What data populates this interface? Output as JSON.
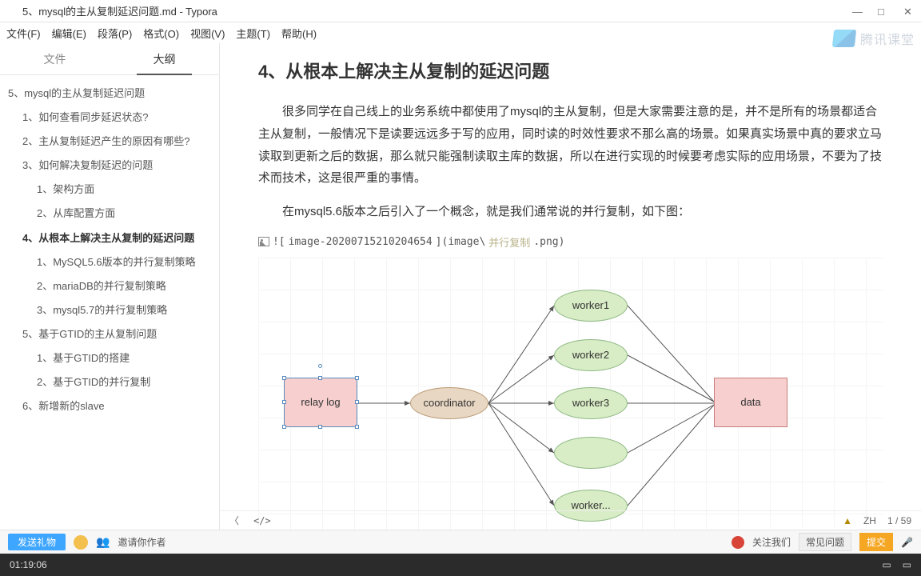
{
  "window": {
    "title": "5、mysql的主从复制延迟问题.md - Typora",
    "min": "—",
    "max": "□",
    "close": "✕"
  },
  "menu": {
    "file": "文件(F)",
    "edit": "编辑(E)",
    "paragraph": "段落(P)",
    "format": "格式(O)",
    "view": "视图(V)",
    "theme": "主题(T)",
    "help": "帮助(H)"
  },
  "sidebar": {
    "tab_file": "文件",
    "tab_outline": "大纲",
    "items": [
      {
        "text": "5、mysql的主从复制延迟问题",
        "level": "l1"
      },
      {
        "text": "1、如何查看同步延迟状态?",
        "level": "l2"
      },
      {
        "text": "2、主从复制延迟产生的原因有哪些?",
        "level": "l2"
      },
      {
        "text": "3、如何解决复制延迟的问题",
        "level": "l2"
      },
      {
        "text": "1、架构方面",
        "level": "l3"
      },
      {
        "text": "2、从库配置方面",
        "level": "l3"
      },
      {
        "text": "4、从根本上解决主从复制的延迟问题",
        "level": "l2",
        "bold": true
      },
      {
        "text": "1、MySQL5.6版本的并行复制策略",
        "level": "l3"
      },
      {
        "text": "2、mariaDB的并行复制策略",
        "level": "l3"
      },
      {
        "text": "3、mysql5.7的并行复制策略",
        "level": "l3"
      },
      {
        "text": "5、基于GTID的主从复制问题",
        "level": "l2"
      },
      {
        "text": "1、基于GTID的搭建",
        "level": "l3"
      },
      {
        "text": "2、基于GTID的并行复制",
        "level": "l3"
      },
      {
        "text": "6、新增新的slave",
        "level": "l2"
      }
    ]
  },
  "editor": {
    "h2": "4、从根本上解决主从复制的延迟问题",
    "p1": "很多同学在自己线上的业务系统中都使用了mysql的主从复制，但是大家需要注意的是，并不是所有的场景都适合主从复制，一般情况下是读要远远多于写的应用，同时读的时效性要求不那么高的场景。如果真实场景中真的要求立马读取到更新之后的数据，那么就只能强制读取主库的数据，所以在进行实现的时候要考虑实际的应用场景，不要为了技术而技术，这是很严重的事情。",
    "p2": "在mysql5.6版本之后引入了一个概念，就是我们通常说的并行复制，如下图：",
    "img_prefix": "![",
    "img_name": "image-20200715210204654",
    "img_mid": "](image\\",
    "img_file": "并行复制",
    "img_suffix": ".png)"
  },
  "diagram": {
    "relay": "relay log",
    "coord": "coordinator",
    "w1": "worker1",
    "w2": "worker2",
    "w3": "worker3",
    "w4": "",
    "w5": "worker...",
    "data": "data"
  },
  "status": {
    "chev": "〈",
    "code": "</>",
    "lang": "ZH",
    "pages": "1 / 59"
  },
  "bottombar": {
    "blue": "发送礼物",
    "chat": "邀请你作者",
    "follow": "关注我们",
    "help": "常见问题",
    "submit": "提交"
  },
  "taskbar": {
    "time": "01:19:06"
  },
  "watermark": {
    "text": "腾讯课堂"
  }
}
